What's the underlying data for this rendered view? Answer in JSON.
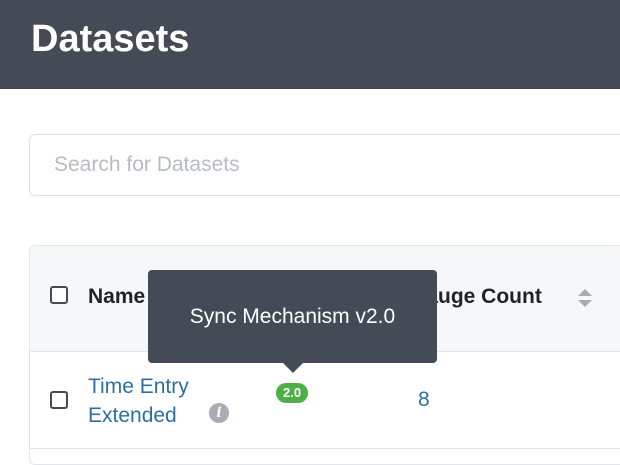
{
  "header": {
    "title": "Datasets"
  },
  "search": {
    "placeholder": "Search for Datasets",
    "value": ""
  },
  "table": {
    "columns": {
      "name": "Name",
      "gauge_count": "Gauge Count"
    },
    "rows": [
      {
        "name": "Time Entry Extended",
        "version_badge": "2.0",
        "gauge_count": "8"
      }
    ]
  },
  "tooltip": {
    "text": "Sync Mechanism v2.0"
  },
  "colors": {
    "header_bg": "#454b56",
    "link": "#2e6fa3",
    "badge": "#4fae45",
    "tooltip_bg": "#454b56"
  },
  "icons": {
    "info": "info-icon",
    "sort": "sort-icon"
  }
}
